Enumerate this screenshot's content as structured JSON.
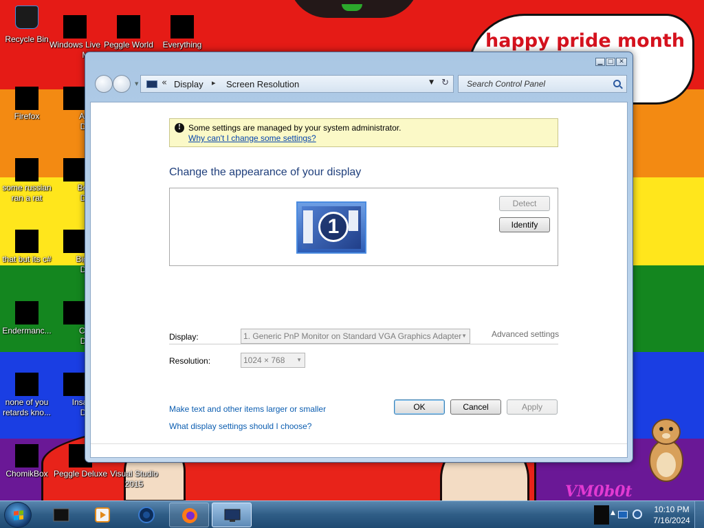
{
  "desktop": {
    "speech_bubble": "happy pride month",
    "watermark": "VM0b0t",
    "icons": [
      {
        "label": "Recycle Bin",
        "label2": ""
      },
      {
        "label": "Windows Live",
        "label2": "Mai"
      },
      {
        "label": "Peggle World",
        "label2": ""
      },
      {
        "label": "Everything",
        "label2": ""
      },
      {
        "label": "Firefox",
        "label2": ""
      },
      {
        "label": "Astro",
        "label2": "Delu"
      },
      {
        "label": "some russian",
        "label2": "ran a rat"
      },
      {
        "label": "Bejew",
        "label2": "Delu"
      },
      {
        "label": "that but its c#",
        "label2": ""
      },
      {
        "label": "Big Mo",
        "label2": "Delu"
      },
      {
        "label": "Endermanc...",
        "label2": ""
      },
      {
        "label": "Chuz",
        "label2": "Delu"
      },
      {
        "label": "none of you",
        "label2": "retards kno..."
      },
      {
        "label": "Insaniq",
        "label2": "Delu"
      },
      {
        "label": "ChomikBox",
        "label2": ""
      },
      {
        "label": "Peggle Deluxe",
        "label2": ""
      },
      {
        "label": "Visual Studio",
        "label2": "2015"
      }
    ]
  },
  "window": {
    "controls": {
      "minimize": "▁",
      "maximize": "□",
      "close": "✕"
    },
    "address": {
      "chevron": "«",
      "crumbs": [
        "Display",
        "Screen Resolution"
      ],
      "separator": "▸",
      "dropdown": "▼",
      "refresh": "↻"
    },
    "search": {
      "placeholder": "Search Control Panel"
    },
    "notice": {
      "icon": "!",
      "text": "Some settings are managed by your system administrator.",
      "link": "Why can't I change some settings?"
    },
    "heading": "Change the appearance of your display",
    "monitor_number": "1",
    "buttons": {
      "detect": "Detect",
      "identify": "Identify",
      "ok": "OK",
      "cancel": "Cancel",
      "apply": "Apply"
    },
    "form": {
      "display_label": "Display:",
      "display_value": "1. Generic PnP Monitor on Standard VGA Graphics Adapter",
      "resolution_label": "Resolution:",
      "resolution_value": "1024 × 768"
    },
    "advanced_settings": "Advanced settings",
    "links": [
      "Make text and other items larger or smaller",
      "What display settings should I choose?"
    ]
  },
  "taskbar": {
    "clock_time": "10:10 PM",
    "clock_date": "7/16/2024",
    "tray_arrow": "▲"
  },
  "colors": {
    "pride_stripes": [
      "#e51b16",
      "#f38a12",
      "#ffe61c",
      "#14861f",
      "#1a3ee3",
      "#6a1896"
    ],
    "link": "#0b5db0",
    "heading": "#1e3e7b",
    "notice_bg": "#fbf9c7"
  }
}
